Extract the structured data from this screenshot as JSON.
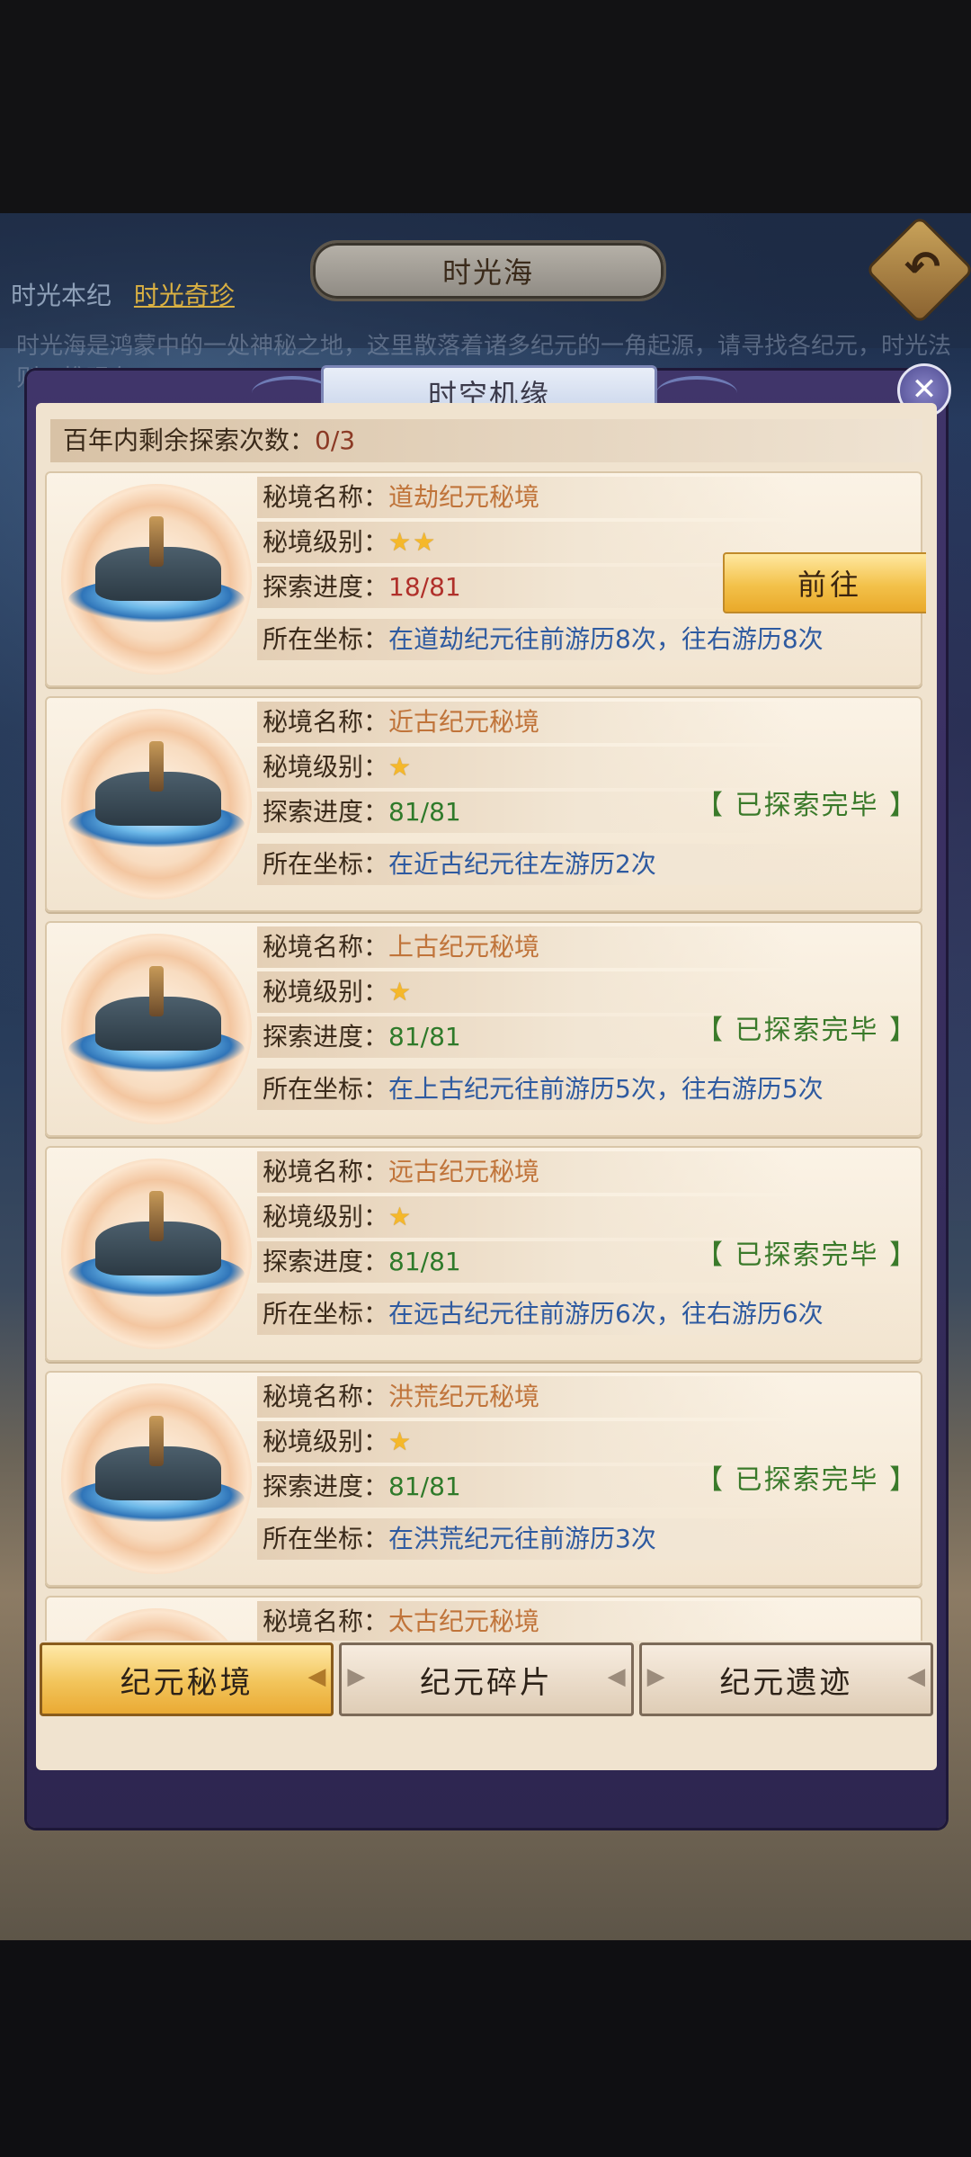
{
  "bg": {
    "title": "时光海",
    "tabs": [
      "时光本纪",
      "时光奇珍"
    ],
    "desc": "时光海是鸿蒙中的一处神秘之地，这里散落着诸多纪元的一角起源，请寻找各纪元，时光法则，推现在，"
  },
  "dialog": {
    "title": "时空机缘",
    "remain_label": "百年内剩余探索次数：",
    "remain_value": "0/3"
  },
  "labels": {
    "name": "秘境名称：",
    "level": "秘境级别：",
    "progress": "探索进度：",
    "coord": "所在坐标："
  },
  "cards": [
    {
      "name": "道劫纪元秘境",
      "stars": "★★",
      "progress": "18/81",
      "coord": "在道劫纪元往前游历8次，往右游历8次",
      "action": "前往",
      "done": ""
    },
    {
      "name": "近古纪元秘境",
      "stars": "★",
      "progress": "81/81",
      "coord": "在近古纪元往左游历2次",
      "action": "",
      "done": "【 已探索完毕 】"
    },
    {
      "name": "上古纪元秘境",
      "stars": "★",
      "progress": "81/81",
      "coord": "在上古纪元往前游历5次，往右游历5次",
      "action": "",
      "done": "【 已探索完毕 】"
    },
    {
      "name": "远古纪元秘境",
      "stars": "★",
      "progress": "81/81",
      "coord": "在远古纪元往前游历6次，往右游历6次",
      "action": "",
      "done": "【 已探索完毕 】"
    },
    {
      "name": "洪荒纪元秘境",
      "stars": "★",
      "progress": "81/81",
      "coord": "在洪荒纪元往前游历3次",
      "action": "",
      "done": "【 已探索完毕 】"
    },
    {
      "name": "太古纪元秘境",
      "stars": "★",
      "progress": "",
      "coord": "",
      "action": "",
      "done": ""
    }
  ],
  "bottom_tabs": [
    "纪元秘境",
    "纪元碎片",
    "纪元遗迹"
  ],
  "colors": {
    "accent": "#f3c14a",
    "progress_low": "#b0302a",
    "progress_done": "#2f7a2a",
    "coord": "#2e5aa0"
  }
}
